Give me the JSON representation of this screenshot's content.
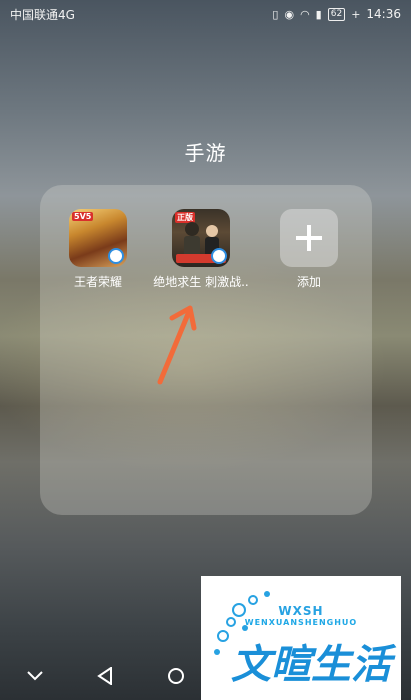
{
  "status_bar": {
    "carrier": "中国联通4G",
    "network": "4G",
    "battery": "62",
    "time": "14:36"
  },
  "folder": {
    "title": "手游",
    "apps": [
      {
        "label": "王者荣耀",
        "icon": "honor-of-kings-icon",
        "tag": "5V5"
      },
      {
        "label": "绝地求生 刺激战..",
        "icon": "pubg-icon",
        "tag": "正版"
      },
      {
        "label": "添加",
        "icon": "plus-icon"
      }
    ]
  },
  "watermark": {
    "top": "WXSH",
    "sub": "WENXUANSHENGHUO",
    "main": "文暄生活"
  },
  "colors": {
    "accent_arrow": "#f26b3a",
    "watermark_blue": "#1a8fd8"
  }
}
